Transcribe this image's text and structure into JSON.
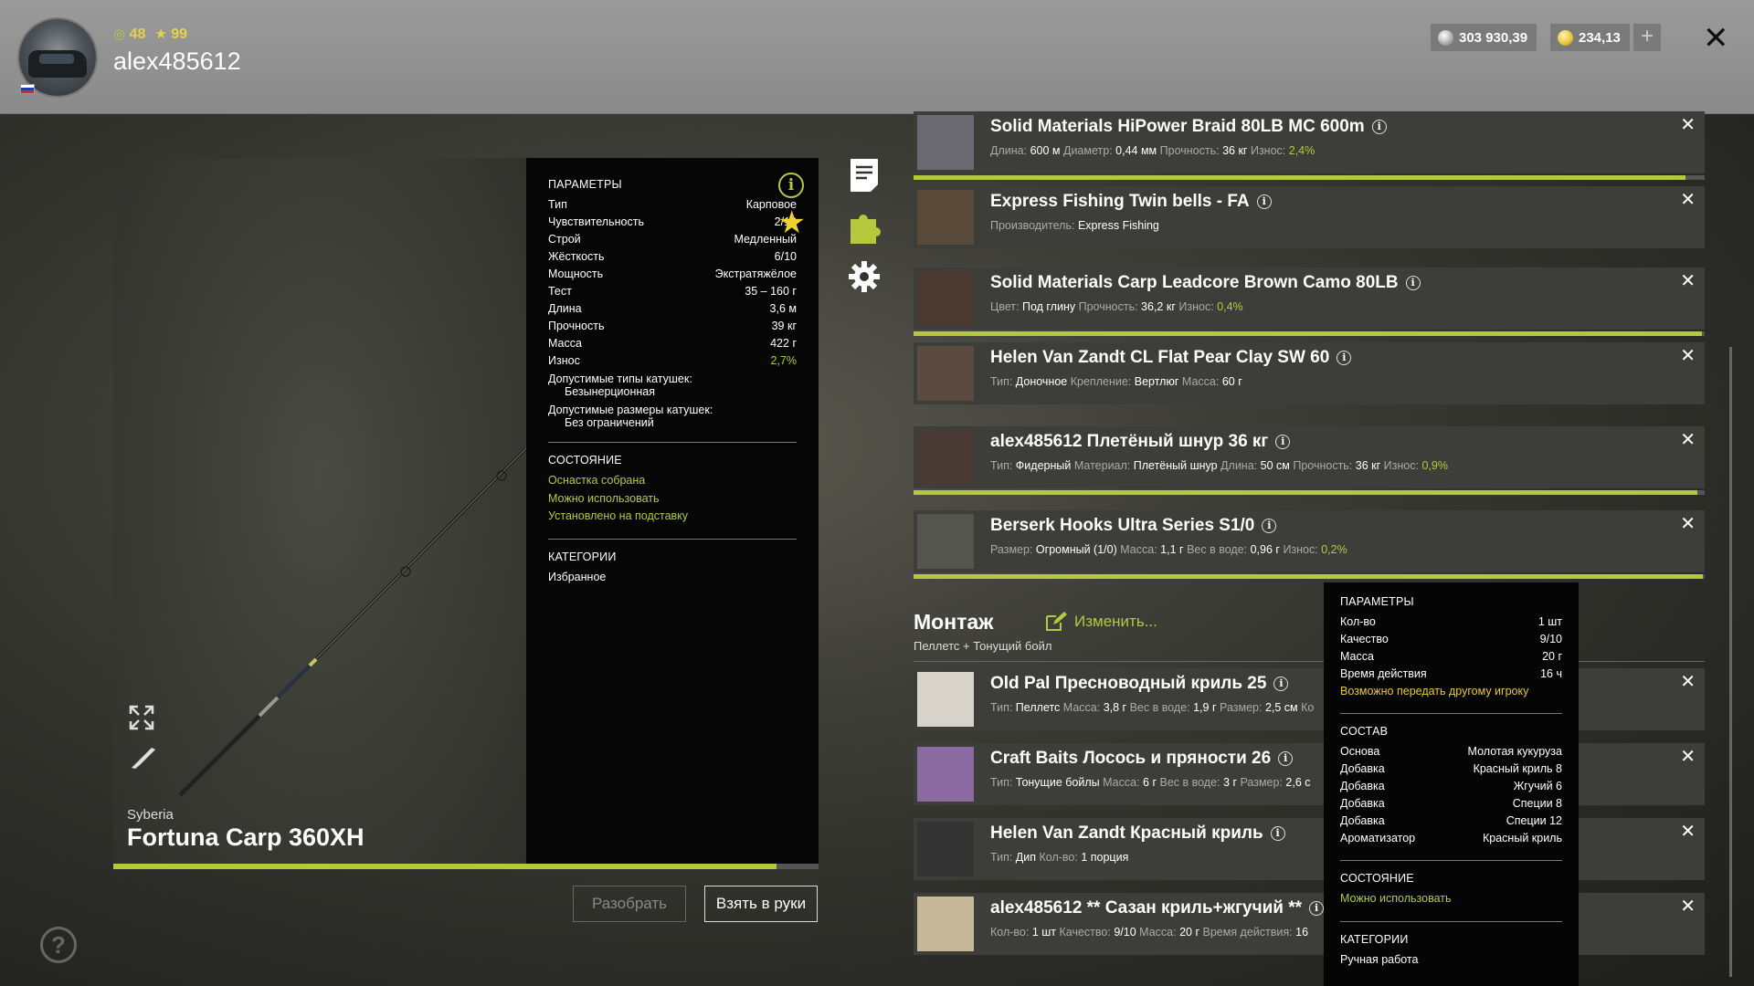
{
  "header": {
    "level": "48",
    "rank": "99",
    "username": "alex485612",
    "silver": "303 930,39",
    "gold": "234,13"
  },
  "preview": {
    "brand": "Syberia",
    "model": "Fortuna Carp 360XH"
  },
  "params": {
    "title": "ПАРАМЕТРЫ",
    "rows": [
      {
        "label": "Тип",
        "value": "Карповое"
      },
      {
        "label": "Чувствительность",
        "value": "2/10"
      },
      {
        "label": "Строй",
        "value": "Медленный"
      },
      {
        "label": "Жёсткость",
        "value": "6/10"
      },
      {
        "label": "Мощность",
        "value": "Экстратяжёлое"
      },
      {
        "label": "Тест",
        "value": "35 – 160 г"
      },
      {
        "label": "Длина",
        "value": "3,6 м"
      },
      {
        "label": "Прочность",
        "value": "39 кг"
      },
      {
        "label": "Масса",
        "value": "422 г"
      },
      {
        "label": "Износ",
        "value": "2,7%"
      }
    ],
    "reel_types_label": "Допустимые типы катушек:",
    "reel_types_value": "Безынерционная",
    "reel_sizes_label": "Допустимые размеры катушек:",
    "reel_sizes_value": "Без ограничений",
    "state_title": "СОСТОЯНИЕ",
    "states": [
      "Оснастка собрана",
      "Можно использовать",
      "Установлено на подставку"
    ],
    "categories_title": "КАТЕГОРИИ",
    "category": "Избранное"
  },
  "buttons": {
    "disassemble": "Разобрать",
    "take": "Взять в руки"
  },
  "items": [
    {
      "name": "Solid Materials HiPower Braid 80LB MC 600m",
      "desc": [
        [
          "Длина:",
          "600 м"
        ],
        [
          "Диаметр:",
          "0,44 мм"
        ],
        [
          "Прочность:",
          "36 кг"
        ],
        [
          "Износ:",
          "2,4%"
        ]
      ],
      "wear": 0.976
    },
    {
      "name": "Express Fishing Twin bells - FA",
      "desc": [
        [
          "Производитель:",
          "Express Fishing"
        ]
      ],
      "wear": null
    },
    {
      "name": "Solid Materials Carp Leadcore Brown Camo 80LB",
      "desc": [
        [
          "Цвет:",
          "Под глину"
        ],
        [
          "Прочность:",
          "36,2 кг"
        ],
        [
          "Износ:",
          "0,4%"
        ]
      ],
      "wear": 0.996
    },
    {
      "name": "Helen Van Zandt CL Flat Pear Clay SW 60",
      "desc": [
        [
          "Тип:",
          "Доночное"
        ],
        [
          "Крепление:",
          "Вертлюг"
        ],
        [
          "Масса:",
          "60 г"
        ]
      ],
      "wear": null
    },
    {
      "name": "alex485612 Плетёный шнур 36 кг",
      "desc": [
        [
          "Тип:",
          "Фидерный"
        ],
        [
          "Материал:",
          "Плетёный шнур"
        ],
        [
          "Длина:",
          "50 см"
        ],
        [
          "Прочность:",
          "36 кг"
        ],
        [
          "Износ:",
          "0,9%"
        ]
      ],
      "wear": 0.991
    },
    {
      "name": "Berserk Hooks Ultra Series S1/0",
      "desc": [
        [
          "Размер:",
          "Огромный (1/0)"
        ],
        [
          "Масса:",
          "1,1 г"
        ],
        [
          "Вес в воде:",
          "0,96 г"
        ],
        [
          "Износ:",
          "0,2%"
        ]
      ],
      "wear": 0.998
    }
  ],
  "montage": {
    "title": "Монтаж",
    "edit": "Изменить...",
    "subtitle": "Пеллетс  +  Тонущий бойл",
    "items": [
      {
        "name": "Old Pal Пресноводный криль 25",
        "desc": [
          [
            "Тип:",
            "Пеллетс"
          ],
          [
            "Масса:",
            "3,8 г"
          ],
          [
            "Вес в воде:",
            "1,9 г"
          ],
          [
            "Размер:",
            "2,5 см"
          ],
          [
            "Ко",
            ""
          ]
        ]
      },
      {
        "name": "Craft Baits Лосось и пряности 26",
        "desc": [
          [
            "Тип:",
            "Тонущие бойлы"
          ],
          [
            "Масса:",
            "6 г"
          ],
          [
            "Вес в воде:",
            "3 г"
          ],
          [
            "Размер:",
            "2,6 с"
          ]
        ]
      },
      {
        "name": "Helen Van Zandt Красный криль",
        "desc": [
          [
            "Тип:",
            "Дип"
          ],
          [
            "Кол-во:",
            "1 порция"
          ]
        ]
      },
      {
        "name": "alex485612 ** Сазан криль+жгучий **",
        "desc": [
          [
            "Кол-во:",
            "1 шт"
          ],
          [
            "Качество:",
            "9/10"
          ],
          [
            "Масса:",
            "20 г"
          ],
          [
            "Время действия:",
            "16"
          ]
        ]
      }
    ]
  },
  "tooltip": {
    "params_title": "ПАРАМЕТРЫ",
    "params": [
      {
        "label": "Кол-во",
        "value": "1 шт"
      },
      {
        "label": "Качество",
        "value": "9/10"
      },
      {
        "label": "Масса",
        "value": "20 г"
      },
      {
        "label": "Время действия",
        "value": "16 ч"
      }
    ],
    "transfer": "Возможно передать другому игроку",
    "composition_title": "СОСТАВ",
    "composition": [
      {
        "label": "Основа",
        "value": "Молотая кукуруза"
      },
      {
        "label": "Добавка",
        "value": "Красный криль 8"
      },
      {
        "label": "Добавка",
        "value": "Жгучий 6"
      },
      {
        "label": "Добавка",
        "value": "Специи 8"
      },
      {
        "label": "Добавка",
        "value": "Специи 12"
      },
      {
        "label": "Ароматизатор",
        "value": "Красный криль"
      }
    ],
    "state_title": "СОСТОЯНИЕ",
    "state": "Можно использовать",
    "categories_title": "КАТЕГОРИИ",
    "category": "Ручная работа"
  }
}
